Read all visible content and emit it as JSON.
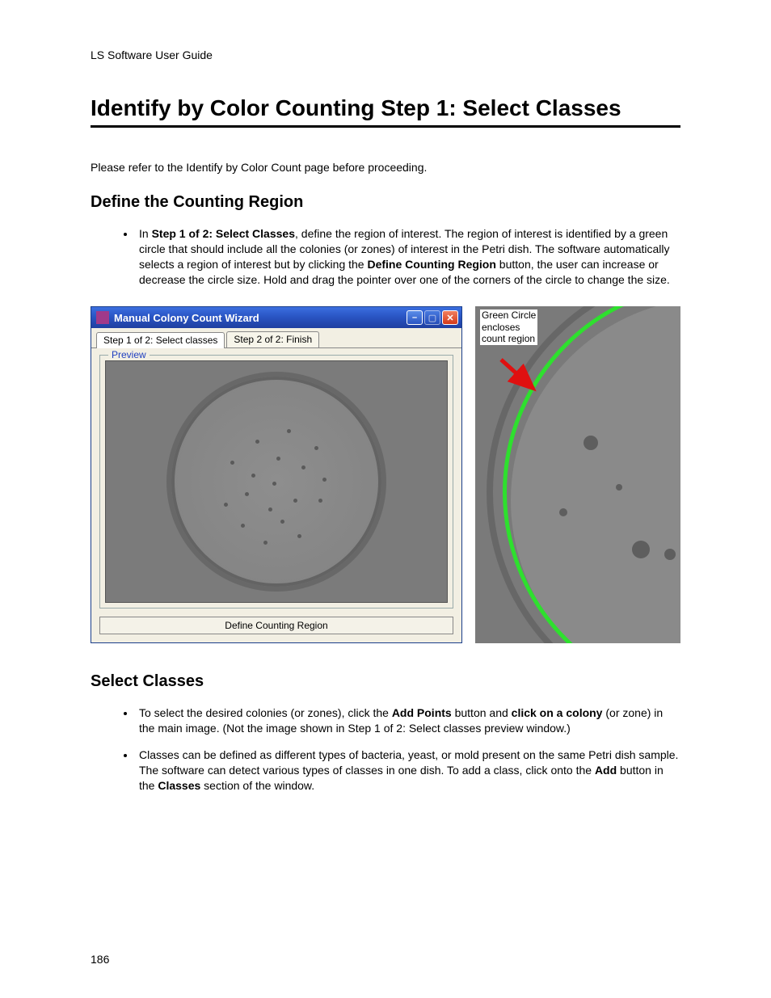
{
  "doc": {
    "running_header": "LS Software User Guide",
    "page_title": "Identify by Color Counting Step 1: Select Classes",
    "intro_para": "Please refer to the Identify by Color Count page before proceeding.",
    "page_number": "186"
  },
  "section1": {
    "heading": "Define the Counting Region",
    "bullet1_pre": "In ",
    "bullet1_bold_step": "Step 1 of 2: Select Classes",
    "bullet1_mid": ", define the region of interest. The region of interest is identified by a green circle that should include all the colonies (or zones) of interest in the Petri dish. The software automatically selects a region of interest but by clicking the ",
    "bullet1_bold_btn": "Define Counting Region",
    "bullet1_post": " button, the user can increase or decrease the circle size. Hold and drag the pointer over one of the corners of the circle to change the size."
  },
  "wizard": {
    "title": "Manual Colony Count Wizard",
    "tab1": "Step 1 of 2: Select classes",
    "tab2": "Step 2 of 2: Finish",
    "preview_label": "Preview",
    "define_btn": "Define Counting Region"
  },
  "detail": {
    "label": "Green Circle\nencloses\ncount region"
  },
  "section2": {
    "heading": "Select Classes",
    "b1_a": "To select the desired colonies (or zones), click the ",
    "b1_bold1": "Add Points",
    "b1_b": " button and ",
    "b1_bold2": "click on a colony",
    "b1_c": " (or zone) in the main image. (Not the image shown in Step 1 of 2: Select classes preview window.)",
    "b2_a": "Classes can be defined as different types of bacteria, yeast, or mold present on the same Petri dish sample. The software can detect various types of classes in one dish. To add a class, click onto the ",
    "b2_bold1": "Add",
    "b2_b": " button in the ",
    "b2_bold2": "Classes",
    "b2_c": " section of the window."
  }
}
